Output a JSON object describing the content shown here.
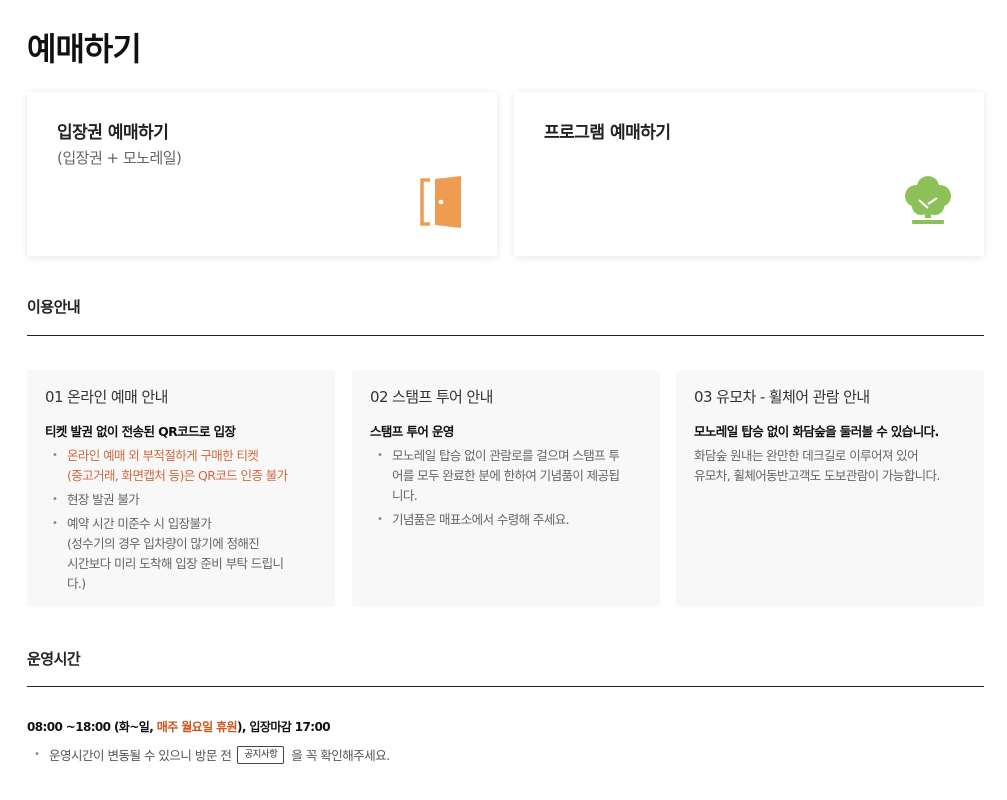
{
  "page": {
    "title": "예매하기"
  },
  "cards": {
    "admission": {
      "title": "입장권 예매하기",
      "subtitle": "(입장권 + 모노레일)",
      "icon": "door-icon",
      "icon_color": "#ee9c52"
    },
    "program": {
      "title": "프로그램 예매하기",
      "icon": "tree-icon",
      "icon_color": "#8cc15a"
    }
  },
  "usage": {
    "title": "이용안내",
    "boxes": [
      {
        "title": "01 온라인 예매 안내",
        "lead": "티켓 발권 없이 전송된 QR코드로 입장",
        "items": [
          {
            "lines": [
              "온라인 예매 외 부적절하게 구매한 티켓",
              "(중고거래, 화면캡처 등)은 QR코드 인증 불가"
            ]
          },
          {
            "lines": [
              "현장 발권 불가"
            ]
          },
          {
            "lines": [
              "예약 시간 미준수 시 입장불가",
              "(성수기의 경우 입차량이 많기에 정해진",
              "시간보다 미리 도착해 입장 준비 부탁 드립니",
              "다.)"
            ]
          }
        ]
      },
      {
        "title": "02 스탬프 투어 안내",
        "lead": "스탬프 투어 운영",
        "items": [
          {
            "lines": [
              "모노레일 탑승 없이 관람로를 걸으며 스탬프 투",
              "어를 모두 완료한 분에 한하여 기념품이 제공됩",
              "니다."
            ]
          },
          {
            "lines": [
              "기념품은 매표소에서 수령해 주세요."
            ]
          }
        ]
      },
      {
        "title": "03 유모차 - 휠체어 관람 안내",
        "lead": "모노레일 탑승 없이 화담숲을 둘러볼 수 있습니다.",
        "lines": [
          "화담숲 원내는 완만한 데크길로 이루어져 있어",
          "유모차, 휠체어동반고객도 도보관람이 가능합니다."
        ]
      }
    ],
    "warn_color": "#d2693e"
  },
  "hours": {
    "title": "운영시간",
    "line_prefix": "08:00 ~18:00 (화~일, ",
    "line_red": "매주 월요일 휴원",
    "line_suffix": "), 입장마감 17:00",
    "note_before": "운영시간이 변동될 수 있으니 방문 전",
    "notice_button": "공지사항",
    "note_after": "을 꼭 확인해주세요."
  }
}
